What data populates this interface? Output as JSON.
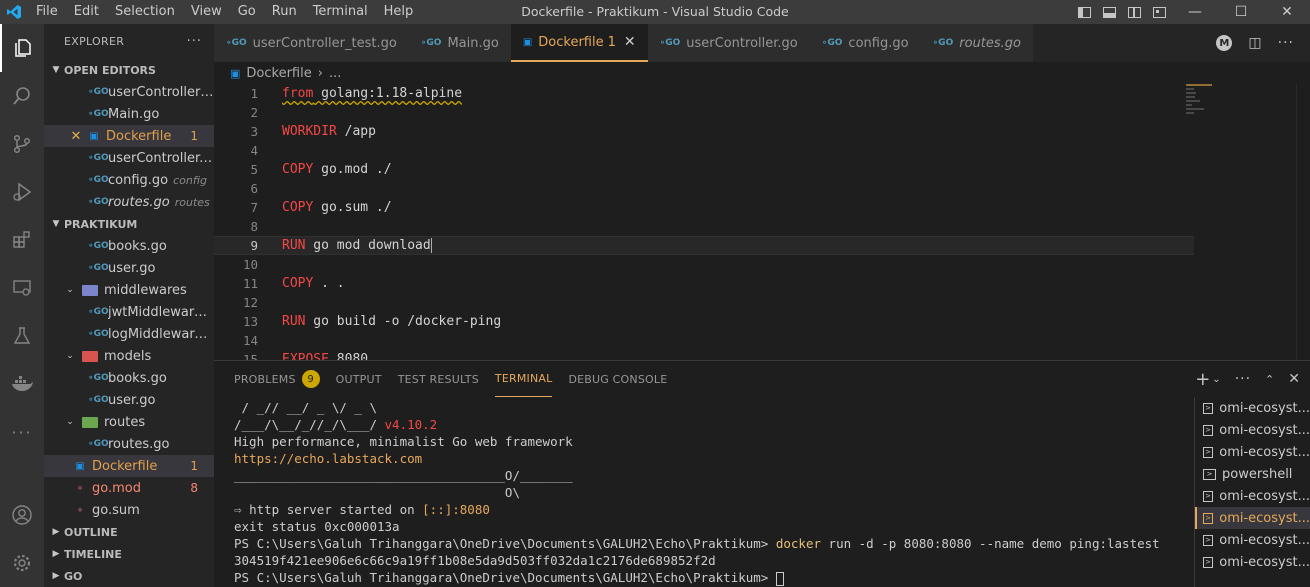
{
  "window": {
    "title": "Dockerfile - Praktikum - Visual Studio Code",
    "menu": [
      "File",
      "Edit",
      "Selection",
      "View",
      "Go",
      "Run",
      "Terminal",
      "Help"
    ]
  },
  "sidebar": {
    "header": "EXPLORER",
    "open_editors_title": "OPEN EDITORS",
    "open_editors": [
      {
        "name": "userController_t...",
        "icon": "go-icon"
      },
      {
        "name": "Main.go",
        "icon": "go-icon"
      },
      {
        "name": "Dockerfile",
        "icon": "docker-icon",
        "badge": "1"
      },
      {
        "name": "userController.g...",
        "icon": "go-icon"
      },
      {
        "name": "config.go",
        "icon": "go-icon",
        "desc": "config"
      },
      {
        "name": "routes.go",
        "icon": "go-icon",
        "desc": "routes"
      }
    ],
    "project_title": "PRAKTIKUM",
    "files": [
      {
        "name": "books.go"
      },
      {
        "name": "user.go"
      },
      {
        "name": "middlewares"
      },
      {
        "name": "jwtMiddleware.go"
      },
      {
        "name": "logMiddlewares...."
      },
      {
        "name": "models"
      },
      {
        "name": "books.go"
      },
      {
        "name": "user.go"
      },
      {
        "name": "routes"
      },
      {
        "name": "routes.go"
      },
      {
        "name": "Dockerfile",
        "badge": "1"
      },
      {
        "name": "go.mod",
        "badge": "8"
      },
      {
        "name": "go.sum"
      }
    ],
    "outline_title": "OUTLINE",
    "timeline_title": "TIMELINE",
    "go_title": "GO"
  },
  "tabs": [
    {
      "label": "userController_test.go"
    },
    {
      "label": "Main.go"
    },
    {
      "label": "Dockerfile",
      "badge": "1"
    },
    {
      "label": "userController.go"
    },
    {
      "label": "config.go"
    },
    {
      "label": "routes.go"
    }
  ],
  "breadcrumb": {
    "file": "Dockerfile",
    "more": "..."
  },
  "editor": {
    "lines": [
      {
        "n": "1",
        "kw": "from",
        "rest": " golang:1.18-alpine"
      },
      {
        "n": "2",
        "kw": "",
        "rest": ""
      },
      {
        "n": "3",
        "kw": "WORKDIR",
        "rest": " /app"
      },
      {
        "n": "4",
        "kw": "",
        "rest": ""
      },
      {
        "n": "5",
        "kw": "COPY",
        "rest": " go.mod ./"
      },
      {
        "n": "6",
        "kw": "",
        "rest": ""
      },
      {
        "n": "7",
        "kw": "COPY",
        "rest": " go.sum ./"
      },
      {
        "n": "8",
        "kw": "",
        "rest": ""
      },
      {
        "n": "9",
        "kw": "RUN",
        "rest": " go mod download"
      },
      {
        "n": "10",
        "kw": "",
        "rest": ""
      },
      {
        "n": "11",
        "kw": "COPY",
        "rest": " . ."
      },
      {
        "n": "12",
        "kw": "",
        "rest": ""
      },
      {
        "n": "13",
        "kw": "RUN",
        "rest": " go build -o /docker-ping"
      },
      {
        "n": "14",
        "kw": "",
        "rest": ""
      },
      {
        "n": "15",
        "kw": "EXPOSE",
        "rest": " 8080"
      }
    ]
  },
  "panel": {
    "tabs": {
      "problems": "PROBLEMS",
      "problems_count": "9",
      "output": "OUTPUT",
      "test_results": "TEST RESULTS",
      "terminal": "TERMINAL",
      "debug_console": "DEBUG CONSOLE"
    },
    "terminal_lines": {
      "l1": " / _// __/ _ \\/ _ \\",
      "l2a": "/___/\\__/_//_/\\___/ ",
      "l2b": "v4.10.2",
      "l3": "High performance, minimalist Go web framework",
      "l4": "https://echo.labstack.com",
      "l5": "____________________________________O/_______",
      "l6": "                                    O\\",
      "l7a": "⇨ ",
      "l7b": "http server started on ",
      "l7c": "[::]:8080",
      "l8": "exit status 0xc000013a",
      "l9a": "PS C:\\Users\\Galuh Trihanggara\\OneDrive\\Documents\\GALUH2\\Echo\\Praktikum> ",
      "l9b": "docker",
      "l9c": " run -d -p 8080:8080 --name demo ping:lastest",
      "l10": "304519f421ee906e6c66c9a19ff1b08e5da9d503ff032da1c2176de689852f2d",
      "l11": "PS C:\\Users\\Galuh Trihanggara\\OneDrive\\Documents\\GALUH2\\Echo\\Praktikum> "
    },
    "terminal_list": [
      {
        "label": "omi-ecosyst..."
      },
      {
        "label": "omi-ecosyst..."
      },
      {
        "label": "omi-ecosyst..."
      },
      {
        "label": "powershell"
      },
      {
        "label": "omi-ecosyst..."
      },
      {
        "label": "omi-ecosyst..."
      },
      {
        "label": "omi-ecosyst..."
      },
      {
        "label": "omi-ecosyst..."
      }
    ]
  },
  "colors": {
    "accent": "#e6a85a",
    "keyword": "#f44747",
    "go": "#519aba",
    "docker": "#1d8fe0"
  }
}
